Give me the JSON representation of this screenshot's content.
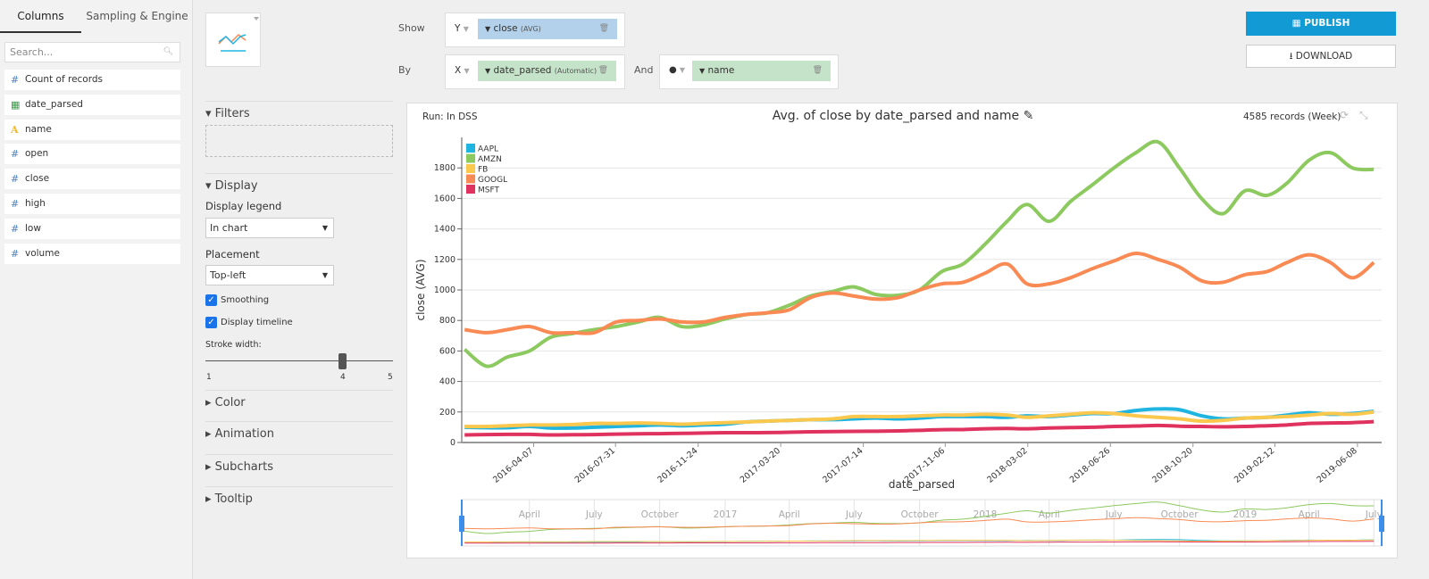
{
  "sidebar": {
    "tabs": [
      "Columns",
      "Sampling & Engine"
    ],
    "search_placeholder": "Search...",
    "columns": [
      {
        "icon": "hash-icon",
        "label": "Count of records"
      },
      {
        "icon": "calendar-icon",
        "label": "date_parsed"
      },
      {
        "icon": "text-type-icon",
        "label": "name"
      },
      {
        "icon": "hash-icon",
        "label": "open"
      },
      {
        "icon": "hash-icon",
        "label": "close"
      },
      {
        "icon": "hash-icon",
        "label": "high"
      },
      {
        "icon": "hash-icon",
        "label": "low"
      },
      {
        "icon": "hash-icon",
        "label": "volume"
      }
    ]
  },
  "settings": {
    "filters": "Filters",
    "display": "Display",
    "display_legend_label": "Display legend",
    "display_legend_value": "In chart",
    "placement_label": "Placement",
    "placement_value": "Top-left",
    "smoothing": "Smoothing",
    "smoothing_checked": true,
    "timeline": "Display timeline",
    "timeline_checked": true,
    "stroke_label": "Stroke width:",
    "stroke_min": "1",
    "stroke_value": "4",
    "stroke_max": "5",
    "color": "Color",
    "animation": "Animation",
    "subcharts": "Subcharts",
    "tooltip": "Tooltip"
  },
  "shelf": {
    "show": "Show",
    "by": "By",
    "and": "And",
    "y": "Y",
    "x": "X",
    "y_field": "close",
    "y_agg": "(AVG)",
    "x_field": "date_parsed",
    "x_agg": "(Automatic)",
    "color_field": "name",
    "y_color": "#b3d1ea",
    "x_color": "#c5e3c8"
  },
  "actions": {
    "publish": "PUBLISH",
    "download": "DOWNLOAD",
    "publish_color": "#129ad4"
  },
  "panel": {
    "run": "Run: In DSS",
    "records": "4585 records (Week)"
  },
  "chart_data": {
    "type": "line",
    "title": "Avg. of close by date_parsed and name",
    "xlabel": "date_parsed",
    "ylabel": "close (AVG)",
    "ylim": [
      0,
      2000
    ],
    "xlim": [
      "2015-12-28",
      "2019-07-12"
    ],
    "grid": true,
    "legend": "top-left",
    "yticks": [
      0,
      200,
      400,
      600,
      800,
      1000,
      1200,
      1400,
      1600,
      1800
    ],
    "xticks": [
      "2016-04-07",
      "2016-07-31",
      "2016-11-24",
      "2017-03-20",
      "2017-07-14",
      "2017-11-06",
      "2018-03-02",
      "2018-06-26",
      "2018-10-20",
      "2019-02-12",
      "2019-06-08"
    ],
    "timeline_ticks": [
      [
        "2016-04-01",
        "April"
      ],
      [
        "2016-07-01",
        "July"
      ],
      [
        "2016-10-01",
        "October"
      ],
      [
        "2017-01-01",
        "2017"
      ],
      [
        "2017-04-01",
        "April"
      ],
      [
        "2017-07-01",
        "July"
      ],
      [
        "2017-10-01",
        "October"
      ],
      [
        "2018-01-01",
        "2018"
      ],
      [
        "2018-04-01",
        "April"
      ],
      [
        "2018-07-01",
        "July"
      ],
      [
        "2018-10-01",
        "October"
      ],
      [
        "2019-01-01",
        "2019"
      ],
      [
        "2019-04-01",
        "April"
      ],
      [
        "2019-07-01",
        "July"
      ]
    ],
    "x": [
      "2016-01-01",
      "2016-02-01",
      "2016-03-01",
      "2016-04-01",
      "2016-05-01",
      "2016-06-01",
      "2016-07-01",
      "2016-08-01",
      "2016-09-01",
      "2016-10-01",
      "2016-11-01",
      "2016-12-01",
      "2017-01-01",
      "2017-02-01",
      "2017-03-01",
      "2017-04-01",
      "2017-05-01",
      "2017-06-01",
      "2017-07-01",
      "2017-08-01",
      "2017-09-01",
      "2017-10-01",
      "2017-11-01",
      "2017-12-01",
      "2018-01-01",
      "2018-02-01",
      "2018-03-01",
      "2018-04-01",
      "2018-05-01",
      "2018-06-01",
      "2018-07-01",
      "2018-08-01",
      "2018-09-01",
      "2018-10-01",
      "2018-11-01",
      "2018-12-01",
      "2019-01-01",
      "2019-02-01",
      "2019-03-01",
      "2019-04-01",
      "2019-05-01",
      "2019-06-01",
      "2019-07-01"
    ],
    "series": [
      {
        "name": "AAPL",
        "color": "#1fb5e0",
        "values": [
          100,
          97,
          97,
          105,
          95,
          95,
          100,
          105,
          110,
          115,
          110,
          115,
          120,
          135,
          140,
          145,
          150,
          150,
          155,
          160,
          155,
          160,
          170,
          170,
          170,
          165,
          175,
          170,
          180,
          190,
          190,
          210,
          220,
          215,
          175,
          155,
          160,
          165,
          180,
          195,
          185,
          190,
          205
        ]
      },
      {
        "name": "AMZN",
        "color": "#8cc95f",
        "values": [
          610,
          500,
          560,
          600,
          690,
          715,
          740,
          760,
          790,
          820,
          760,
          770,
          810,
          840,
          850,
          900,
          960,
          990,
          1020,
          970,
          965,
          1000,
          1120,
          1170,
          1300,
          1450,
          1560,
          1450,
          1580,
          1690,
          1800,
          1900,
          1970,
          1800,
          1600,
          1500,
          1650,
          1620,
          1700,
          1850,
          1900,
          1800,
          1790
        ]
      },
      {
        "name": "FB",
        "color": "#fbc84e",
        "values": [
          105,
          105,
          110,
          115,
          115,
          118,
          125,
          125,
          128,
          125,
          120,
          125,
          130,
          135,
          140,
          145,
          150,
          155,
          170,
          170,
          170,
          175,
          180,
          180,
          185,
          180,
          165,
          175,
          185,
          195,
          190,
          175,
          165,
          155,
          140,
          145,
          160,
          165,
          170,
          180,
          190,
          185,
          200
        ]
      },
      {
        "name": "GOOGL",
        "color": "#f98a54",
        "values": [
          740,
          720,
          740,
          760,
          720,
          720,
          720,
          790,
          800,
          810,
          790,
          790,
          820,
          840,
          850,
          870,
          950,
          980,
          960,
          940,
          950,
          1000,
          1040,
          1050,
          1110,
          1170,
          1040,
          1040,
          1080,
          1140,
          1190,
          1240,
          1200,
          1150,
          1060,
          1050,
          1100,
          1120,
          1180,
          1230,
          1180,
          1080,
          1180
        ]
      },
      {
        "name": "MSFT",
        "color": "#e0325e",
        "values": [
          50,
          52,
          53,
          53,
          50,
          51,
          52,
          55,
          57,
          58,
          60,
          62,
          64,
          64,
          65,
          67,
          70,
          72,
          73,
          74,
          76,
          80,
          84,
          85,
          90,
          92,
          90,
          95,
          98,
          100,
          105,
          108,
          112,
          107,
          105,
          103,
          105,
          110,
          115,
          125,
          128,
          130,
          137
        ]
      }
    ]
  }
}
